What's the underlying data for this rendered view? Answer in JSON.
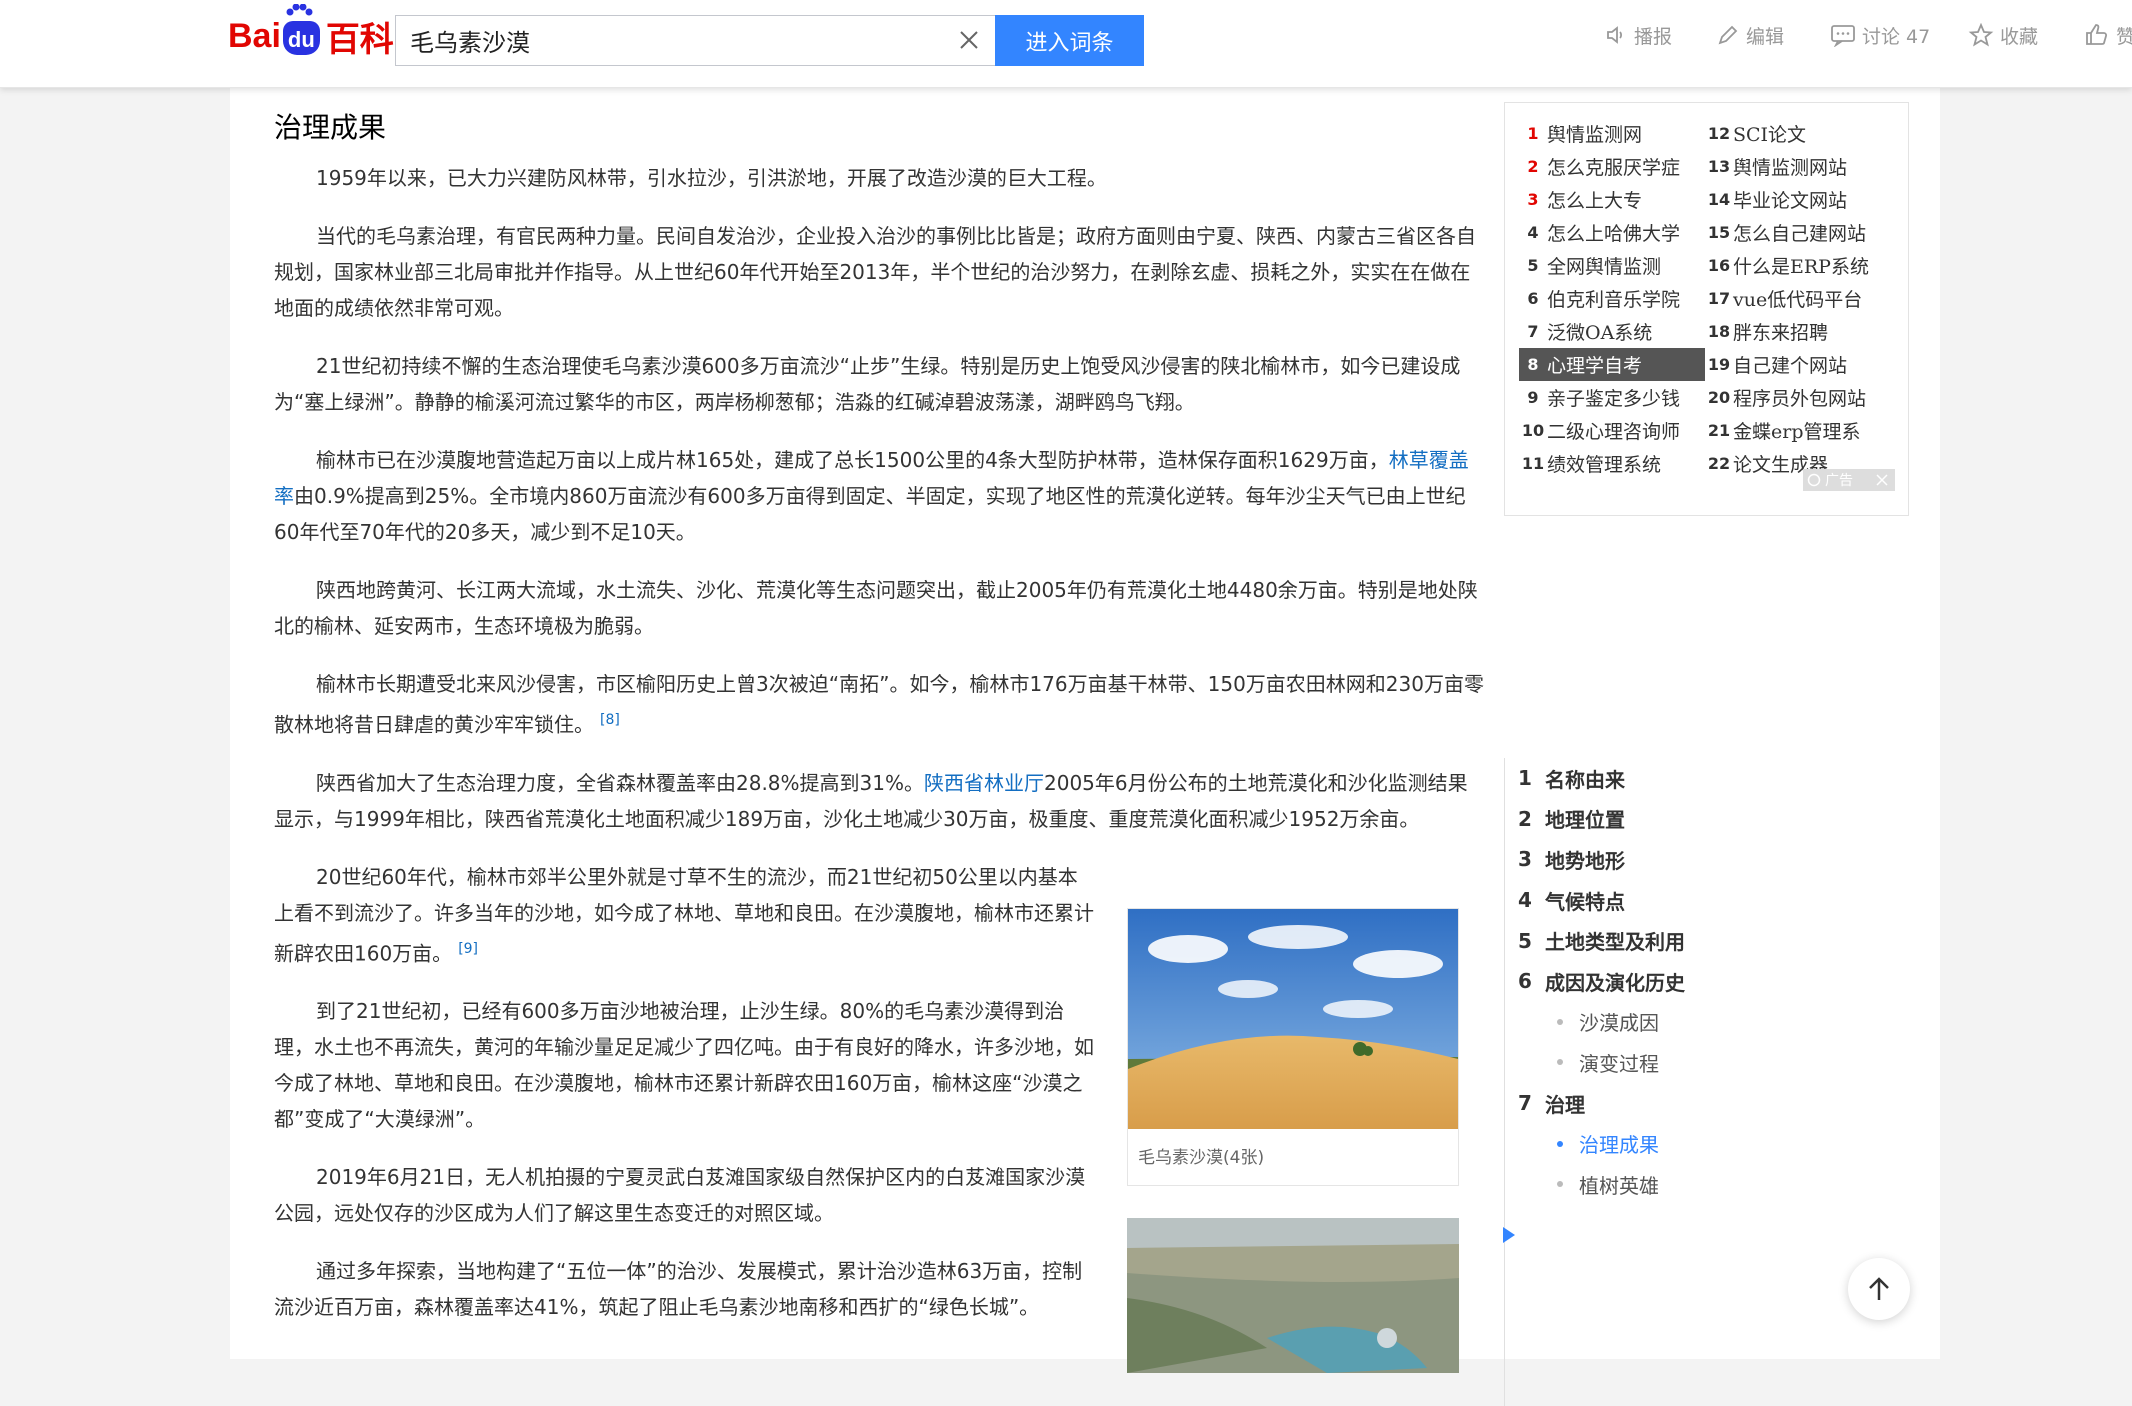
{
  "header": {
    "logo_bai": "Bai",
    "logo_du": "du",
    "logo_baike": "百科",
    "search_value": "毛乌素沙漠",
    "enter_label": "进入词条",
    "actions": {
      "play": "播报",
      "edit": "编辑",
      "discuss": "讨论 47",
      "collect": "收藏",
      "like": "赞"
    }
  },
  "article": {
    "section_title": "治理成果",
    "p1": "1959年以来，已大力兴建防风林带，引水拉沙，引洪淤地，开展了改造沙漠的巨大工程。",
    "p2": "当代的毛乌素治理，有官民两种力量。民间自发治沙，企业投入治沙的事例比比皆是；政府方面则由宁夏、陕西、内蒙古三省区各自规划，国家林业部三北局审批并作指导。从上世纪60年代开始至2013年，半个世纪的治沙努力，在剥除玄虚、损耗之外，实实在在做在地面的成绩依然非常可观。",
    "p3": "21世纪初持续不懈的生态治理使毛乌素沙漠600多万亩流沙“止步”生绿。特别是历史上饱受风沙侵害的陕北榆林市，如今已建设成为“塞上绿洲”。静静的榆溪河流过繁华的市区，两岸杨柳葱郁；浩淼的红碱淖碧波荡漾，湖畔鸥鸟飞翔。",
    "p4_before": "榆林市已在沙漠腹地营造起万亩以上成片林165处，建成了总长1500公里的4条大型防护林带，造林保存面积1629万亩，",
    "p4_link": "林草覆盖率",
    "p4_after": "由0.9%提高到25%。全市境内860万亩流沙有600多万亩得到固定、半固定，实现了地区性的荒漠化逆转。每年沙尘天气已由上世纪60年代至70年代的20多天，减少到不足10天。",
    "p5": "陕西地跨黄河、长江两大流域，水土流失、沙化、荒漠化等生态问题突出，截止2005年仍有荒漠化土地4480余万亩。特别是地处陕北的榆林、延安两市，生态环境极为脆弱。",
    "p6": "榆林市长期遭受北来风沙侵害，市区榆阳历史上曾3次被迫“南拓”。如今，榆林市176万亩基干林带、150万亩农田林网和230万亩零散林地将昔日肆虐的黄沙牢牢锁住。",
    "p6_ref": "[8]",
    "p7_before": "陕西省加大了生态治理力度，全省森林覆盖率由28.8%提高到31%。",
    "p7_link": "陕西省林业厅",
    "p7_after": "2005年6月份公布的土地荒漠化和沙化监测结果显示，与1999年相比，陕西省荒漠化土地面积减少189万亩，沙化土地减少30万亩，极重度、重度荒漠化面积减少1952万余亩。",
    "p8": "20世纪60年代，榆林市郊半公里外就是寸草不生的流沙，而21世纪初50公里以内基本上看不到流沙了。许多当年的沙地，如今成了林地、草地和良田。在沙漠腹地，榆林市还累计新辟农田160万亩。",
    "p8_ref": "[9]",
    "p9": "到了21世纪初，已经有600多万亩沙地被治理，止沙生绿。80%的毛乌素沙漠得到治理，水土也不再流失，黄河的年输沙量足足减少了四亿吨。由于有良好的降水，许多沙地，如今成了林地、草地和良田。在沙漠腹地，榆林市还累计新辟农田160万亩，榆林这座“沙漠之都”变成了“大漠绿洲”。",
    "p10": "2019年6月21日，无人机拍摄的宁夏灵武白芨滩国家级自然保护区内的白芨滩国家沙漠公园，远处仅存的沙区成为人们了解这里生态变迁的对照区域。",
    "p11": "通过多年探索，当地构建了“五位一体”的治沙、发展模式，累计治沙造林63万亩，控制流沙近百万亩，森林覆盖率达41%，筑起了阻止毛乌素沙地南移和西扩的“绿色长城”。",
    "image_caption": "毛乌素沙漠(4张)"
  },
  "ad": {
    "left": [
      {
        "num": "1",
        "label": "舆情监测网",
        "hot": true
      },
      {
        "num": "2",
        "label": "怎么克服厌学症",
        "hot": true
      },
      {
        "num": "3",
        "label": "怎么上大专",
        "hot": true
      },
      {
        "num": "4",
        "label": "怎么上哈佛大学",
        "hot": false
      },
      {
        "num": "5",
        "label": "全网舆情监测",
        "hot": false
      },
      {
        "num": "6",
        "label": "伯克利音乐学院",
        "hot": false
      },
      {
        "num": "7",
        "label": "泛微OA系统",
        "hot": false
      },
      {
        "num": "8",
        "label": "心理学自考",
        "hot": false
      },
      {
        "num": "9",
        "label": "亲子鉴定多少钱",
        "hot": false
      },
      {
        "num": "10",
        "label": "二级心理咨询师",
        "hot": false
      },
      {
        "num": "11",
        "label": "绩效管理系统",
        "hot": false
      }
    ],
    "right": [
      {
        "num": "12",
        "label": "SCI论文"
      },
      {
        "num": "13",
        "label": "舆情监测网站"
      },
      {
        "num": "14",
        "label": "毕业论文网站"
      },
      {
        "num": "15",
        "label": "怎么自己建网站"
      },
      {
        "num": "16",
        "label": "什么是ERP系统"
      },
      {
        "num": "17",
        "label": "vue低代码平台"
      },
      {
        "num": "18",
        "label": "胖东来招聘"
      },
      {
        "num": "19",
        "label": "自己建个网站"
      },
      {
        "num": "20",
        "label": "程序员外包网站"
      },
      {
        "num": "21",
        "label": "金蝶erp管理系"
      },
      {
        "num": "22",
        "label": "论文生成器"
      }
    ],
    "badge": "广告"
  },
  "toc": {
    "items": [
      {
        "num": "1",
        "label": "名称由来"
      },
      {
        "num": "2",
        "label": "地理位置"
      },
      {
        "num": "3",
        "label": "地势地形"
      },
      {
        "num": "4",
        "label": "气候特点"
      },
      {
        "num": "5",
        "label": "土地类型及利用"
      },
      {
        "num": "6",
        "label": "成因及演化历史"
      }
    ],
    "sub6": [
      "沙漠成因",
      "演变过程"
    ],
    "item7": {
      "num": "7",
      "label": "治理"
    },
    "sub7": [
      "治理成果",
      "植树英雄"
    ]
  },
  "colors": {
    "brand_red": "#e10602",
    "brand_blue": "#2932e1",
    "button_blue": "#3385ff",
    "link_blue": "#136ec2"
  }
}
